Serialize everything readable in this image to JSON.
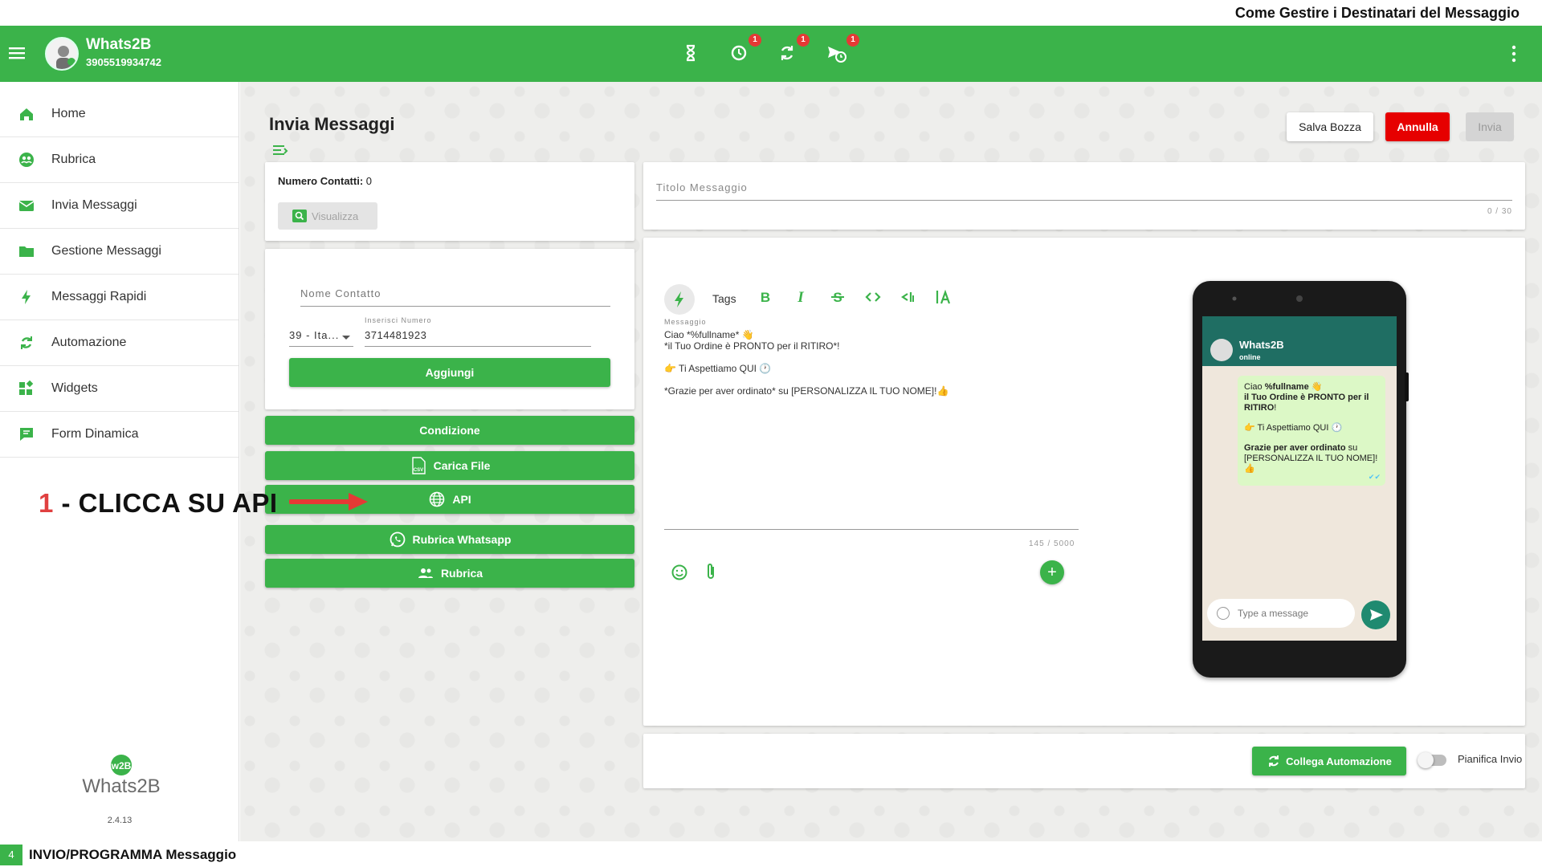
{
  "doc_title": "Come Gestire i Destinatari del Messaggio",
  "app": {
    "name": "Whats2B",
    "phone": "3905519934742"
  },
  "topbar": {
    "icons": [
      {
        "name": "hourglass-icon",
        "badge": ""
      },
      {
        "name": "history-icon",
        "badge": "1"
      },
      {
        "name": "sync-icon",
        "badge": "1"
      },
      {
        "name": "scheduled-send-icon",
        "badge": "1"
      }
    ]
  },
  "sidebar": {
    "items": [
      {
        "label": "Home",
        "icon": "home-icon"
      },
      {
        "label": "Rubrica",
        "icon": "contacts-icon"
      },
      {
        "label": "Invia Messaggi",
        "icon": "mail-icon"
      },
      {
        "label": "Gestione Messaggi",
        "icon": "folder-icon"
      },
      {
        "label": "Messaggi Rapidi",
        "icon": "bolt-icon"
      },
      {
        "label": "Automazione",
        "icon": "sync-icon"
      },
      {
        "label": "Widgets",
        "icon": "widgets-icon"
      },
      {
        "label": "Form Dinamica",
        "icon": "form-icon"
      }
    ],
    "logo_text": "Whats2B",
    "logo_badge": "w2B",
    "version": "2.4.13"
  },
  "page": {
    "title": "Invia Messaggi",
    "buttons": {
      "salva": "Salva Bozza",
      "annulla": "Annulla",
      "invia": "Invia"
    }
  },
  "contacts": {
    "count_label": "Numero Contatti:",
    "count_value": "0",
    "visualizza": "Visualizza",
    "nome_placeholder": "Nome Contatto",
    "prefix": "39 - Ita...",
    "numero_label": "Inserisci Numero",
    "numero_value": "3714481923",
    "aggiungi": "Aggiungi"
  },
  "actions": {
    "condizione": "Condizione",
    "carica_file": "Carica File",
    "api": "API",
    "rubrica_whatsapp": "Rubrica Whatsapp",
    "rubrica": "Rubrica"
  },
  "annotation": {
    "number": "1",
    "text": " - CLICCA SU API"
  },
  "message": {
    "title_placeholder": "Titolo Messaggio",
    "title_counter": "0 / 30",
    "tags_label": "Tags",
    "field_label": "Messaggio",
    "lines": [
      "Ciao *%fullname* 👋",
      "*il Tuo Ordine è PRONTO per il RITIRO*!",
      "",
      "👉 Ti Aspettiamo QUI 🕐",
      "",
      "*Grazie per aver ordinato* su [PERSONALIZZA IL TUO NOME]!👍"
    ],
    "counter": "145 / 5000"
  },
  "preview": {
    "contact_name": "Whats2B",
    "status": "online",
    "greeting": "Ciao ",
    "greeting_bold": "%fullname",
    "greeting_emoji": " 👋",
    "line2": "il Tuo Ordine è PRONTO per il RITIRO",
    "line2_end": "!",
    "line3": "👉 Ti Aspettiamo QUI 🕐",
    "line4_bold": "Grazie per aver ordinato",
    "line4": " su [PERSONALIZZA IL TUO NOME]!👍",
    "input_placeholder": "Type a message"
  },
  "footer": {
    "collega": "Collega Automazione",
    "pianifica": "Pianifica Invio"
  },
  "bottom": {
    "step": "4",
    "text": "INVIO/PROGRAMMA Messaggio"
  },
  "colors": {
    "brand_green": "#3bb34a",
    "danger": "#e60000",
    "wa_header": "#1f6e63",
    "bubble": "#dcf8c6"
  }
}
